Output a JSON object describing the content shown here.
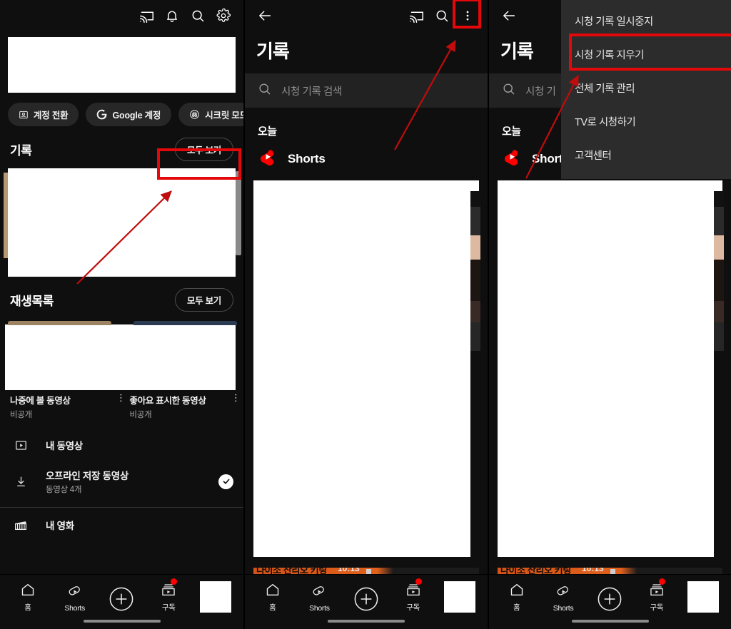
{
  "meta": {
    "accent_red": "#e4080a",
    "brand_red": "#ff0000",
    "bg": "#0f0f0f",
    "menu_bg": "#2c2c2c"
  },
  "panel1": {
    "name": "youtube-library-screen",
    "topbar": {
      "cast": "cast-icon",
      "notifications": "bell-icon",
      "search": "search-icon",
      "settings": "gear-icon"
    },
    "chips": [
      {
        "label": "계정 전환",
        "icon": "switch-account-icon"
      },
      {
        "label": "Google 계정",
        "icon": "google-g-icon"
      },
      {
        "label": "시크릿 모드",
        "icon": "incognito-icon"
      }
    ],
    "history_section": {
      "title": "기록",
      "see_all": "모두 보기"
    },
    "playlists_section": {
      "title": "재생목록",
      "see_all": "모두 보기",
      "items": [
        {
          "title": "나중에 볼 동영상",
          "subtitle": "비공개"
        },
        {
          "title": "좋아요 표시한 동영상",
          "subtitle": "비공개"
        }
      ]
    },
    "list_rows": [
      {
        "label": "내 동영상",
        "sub": "",
        "icon": "play-box-icon",
        "checked": false
      },
      {
        "label": "오프라인 저장 동영상",
        "sub": "동영상 4개",
        "icon": "download-icon",
        "checked": true
      },
      {
        "label": "내 영화",
        "sub": "",
        "icon": "clapperboard-icon",
        "checked": false
      }
    ]
  },
  "panel2": {
    "name": "watch-history-screen",
    "topbar": {
      "back": "back-arrow-icon",
      "cast": "cast-icon",
      "search": "search-icon",
      "overflow": "more-vertical-icon"
    },
    "title": "기록",
    "search_placeholder": "시청 기록 검색",
    "today_label": "오늘",
    "shorts_label": "Shorts",
    "cut_text": "다이소 산리오 키링",
    "cut_time": "10:13"
  },
  "panel3": {
    "name": "watch-history-overflow-menu-screen",
    "topbar": {
      "back": "back-arrow-icon"
    },
    "title": "기록",
    "search_placeholder": "시청 기",
    "today_label": "오늘",
    "shorts_label": "Shorts",
    "cut_text": "다이소 산리오 키링",
    "cut_time": "10:13",
    "menu_items": [
      {
        "label": "시청 기록 일시중지",
        "highlighted": false
      },
      {
        "label": "시청 기록 지우기",
        "highlighted": true
      },
      {
        "label": "전체 기록 관리",
        "highlighted": false
      },
      {
        "label": "TV로 시청하기",
        "highlighted": false
      },
      {
        "label": "고객센터",
        "highlighted": false
      }
    ]
  },
  "bottom_nav": {
    "items": [
      {
        "label": "홈",
        "icon": "home-icon",
        "badge": false
      },
      {
        "label": "Shorts",
        "icon": "shorts-icon",
        "badge": false
      },
      {
        "label": "",
        "icon": "create-plus-icon",
        "badge": false
      },
      {
        "label": "구독",
        "icon": "subscriptions-icon",
        "badge": true
      }
    ],
    "avatar": "account-avatar"
  }
}
